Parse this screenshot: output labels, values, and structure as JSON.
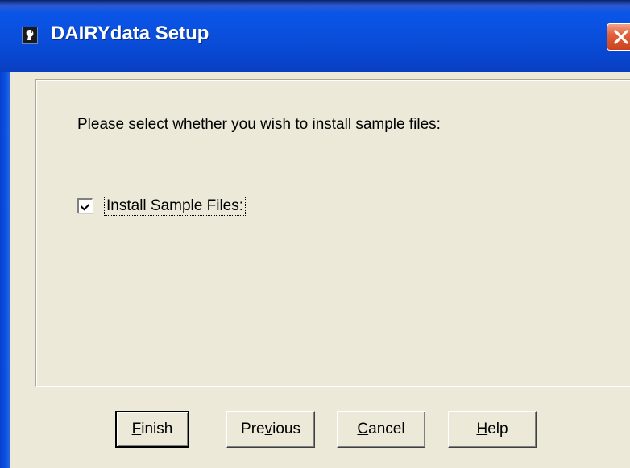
{
  "window": {
    "title": "DAIRYdata Setup",
    "title_icon": "app-icon",
    "close_icon": "close-icon",
    "colors": {
      "titlebar": "#0a55e8",
      "close": "#e2603a",
      "face": "#ece9d8"
    }
  },
  "content": {
    "prompt": "Please select whether you wish to install sample files:",
    "checkbox": {
      "label": "Install Sample Files:",
      "checked": true
    }
  },
  "buttons": {
    "finish": {
      "pre": "",
      "accel": "F",
      "post": "inish"
    },
    "previous": {
      "pre": "Pre",
      "accel": "v",
      "post": "ious"
    },
    "cancel": {
      "pre": "",
      "accel": "C",
      "post": "ancel"
    },
    "help": {
      "pre": "",
      "accel": "H",
      "post": "elp"
    }
  }
}
